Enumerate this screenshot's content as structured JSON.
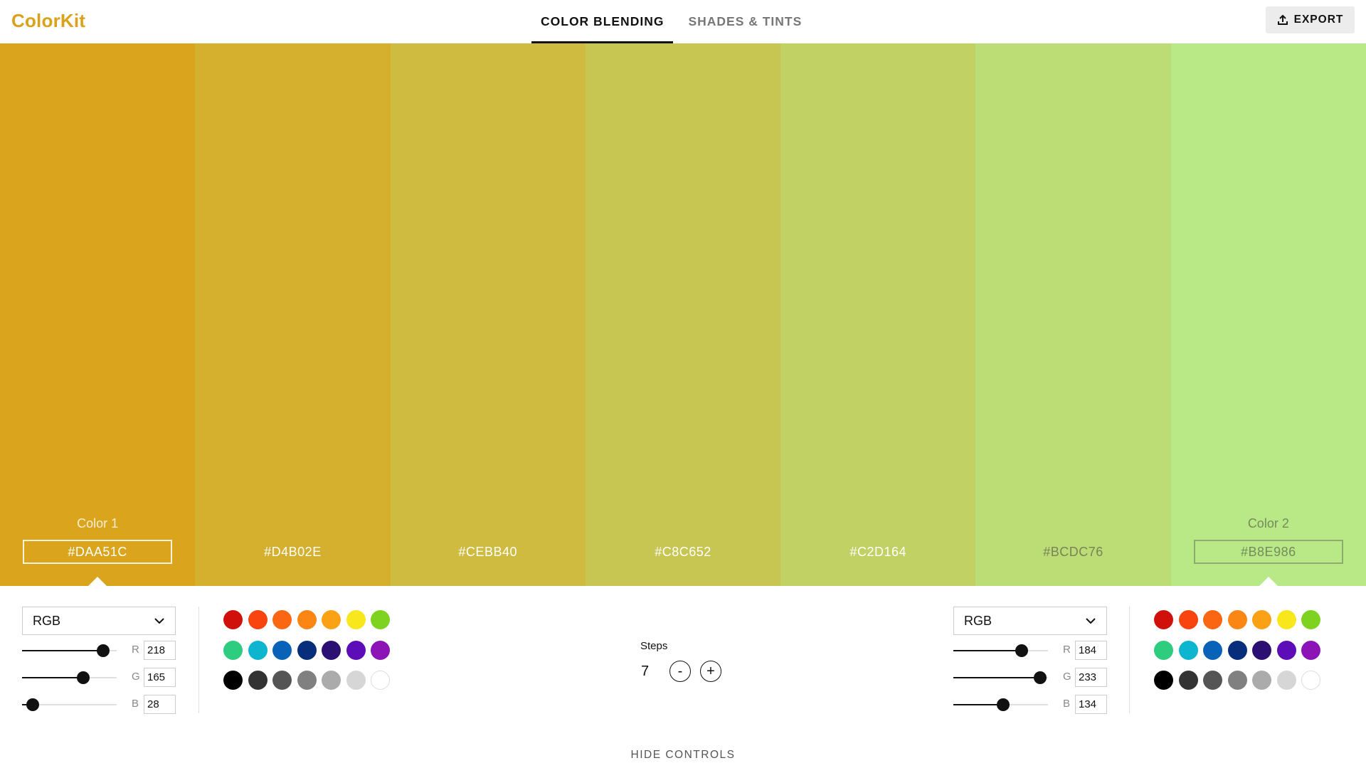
{
  "app": {
    "title": "ColorKit",
    "tabs": [
      {
        "label": "COLOR BLENDING",
        "active": true
      },
      {
        "label": "SHADES & TINTS",
        "active": false
      }
    ],
    "export_label": "EXPORT"
  },
  "swatches": [
    {
      "hex": "#DAA51C",
      "color": "#DAA51C",
      "label": "Color 1",
      "selected": true
    },
    {
      "hex": "#D4B02E",
      "color": "#D4B02E",
      "label": "",
      "selected": false
    },
    {
      "hex": "#CEBB40",
      "color": "#CEBB40",
      "label": "",
      "selected": false
    },
    {
      "hex": "#C8C652",
      "color": "#C8C652",
      "label": "",
      "selected": false
    },
    {
      "hex": "#C2D164",
      "color": "#C2D164",
      "label": "",
      "selected": false
    },
    {
      "hex": "#BCDC76",
      "color": "#BCDC76",
      "label": "",
      "selected": false
    },
    {
      "hex": "#B8E986",
      "color": "#B8E986",
      "label": "Color 2",
      "selected": true
    }
  ],
  "color1": {
    "mode": "RGB",
    "channels": [
      {
        "letter": "R",
        "value": "218"
      },
      {
        "letter": "G",
        "value": "165"
      },
      {
        "letter": "B",
        "value": "28"
      }
    ]
  },
  "color2": {
    "mode": "RGB",
    "channels": [
      {
        "letter": "R",
        "value": "184"
      },
      {
        "letter": "G",
        "value": "233"
      },
      {
        "letter": "B",
        "value": "134"
      }
    ]
  },
  "palette_colors": [
    "#D0110B",
    "#FA4410",
    "#FB6612",
    "#FB8614",
    "#FBA115",
    "#F8E71C",
    "#7ED321",
    "#2DCC7F",
    "#0EB5CF",
    "#0863B8",
    "#072E7A",
    "#2B0F72",
    "#5D0DB7",
    "#8C13B5",
    "#000000",
    "#333333",
    "#555555",
    "#808080",
    "#ABABAB",
    "#D6D6D6",
    "#FFFFFF"
  ],
  "steps": {
    "label": "Steps",
    "value": "7",
    "minus": "-",
    "plus": "+"
  },
  "hide_controls_label": "HIDE CONTROLS",
  "colors": {
    "brand": "#D9A21A"
  }
}
